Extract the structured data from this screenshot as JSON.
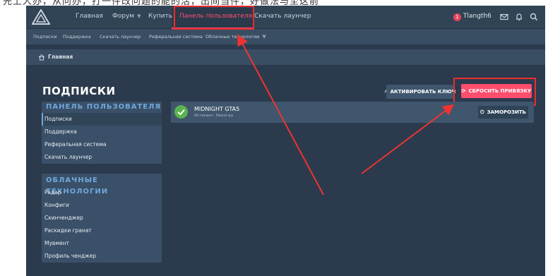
{
  "top_strip": {
    "text": "先上人办，从问办，打一件改问题的能的活，出间当件，好做法与至这前"
  },
  "nav": {
    "items": [
      "Главная",
      "Форум",
      "Купить",
      "Панель пользователя",
      "Скачать лаунчер"
    ],
    "active_index": 3,
    "user": {
      "badge": "1",
      "name": "Tlangth6"
    },
    "icons": [
      "mail-icon",
      "bell-icon",
      "search-icon"
    ]
  },
  "subnav": {
    "items": [
      "Подписки",
      "Поддержка",
      "Скачать лаунчер",
      "Реферальная система",
      "Облачные технологии"
    ]
  },
  "breadcrumb": {
    "home": "Главная"
  },
  "page": {
    "title": "ПОДПИСКИ",
    "activate_label": "АКТИВИРОВАТЬ КЛЮЧ",
    "reset_label": "СБРОСИТЬ ПРИВЯЗКУ"
  },
  "sidebar": {
    "panel": {
      "title": "ПАНЕЛЬ ПОЛЬЗОВАТЕЛЯ",
      "items": [
        "Подписки",
        "Поддержка",
        "Реферальная система",
        "Скачать лаунчер"
      ]
    },
    "cloud": {
      "title": "ОБЛАЧНЫЕ ТЕХНОЛОГИИ",
      "items": [
        "Радар",
        "Конфиги",
        "Скинченджер",
        "Раскидки гранат",
        "Мувмент",
        "Профиль ченджер"
      ]
    }
  },
  "subscription": {
    "name": "MIDNIGHT GTA5",
    "expires": "Истекает: Никогда",
    "freeze_label": "ЗАМОРОЗИТЬ"
  },
  "colors": {
    "accent": "#ff4d73",
    "annotation": "#ee2b2b",
    "background": "#2b3b4d",
    "success": "#5ab34f"
  }
}
